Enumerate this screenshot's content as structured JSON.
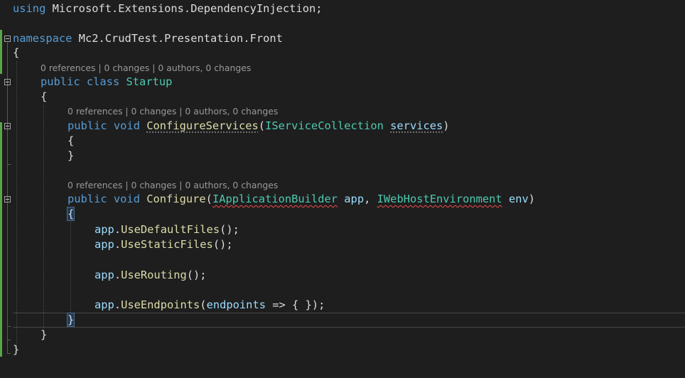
{
  "editor": {
    "code": {
      "line1": {
        "kw": "using",
        "rest": " Microsoft.Extensions.DependencyInjection;"
      },
      "line2": {
        "kw": "namespace",
        "rest": " Mc2.CrudTest.Presentation.Front"
      },
      "open_brace": "{",
      "class_decl": {
        "kw1": "public",
        "kw2": "class",
        "name": "Startup"
      },
      "configure_services": {
        "kw1": "public",
        "kw2": "void",
        "name": "ConfigureServices",
        "open": "(",
        "param_type": "IServiceCollection",
        "param_name": "services",
        "close": ")"
      },
      "configure": {
        "kw1": "public",
        "kw2": "void",
        "name": "Configure",
        "open": "(",
        "param1_type": "IApplicationBuilder",
        "param1_name": "app",
        "sep": ", ",
        "param2_type": "IWebHostEnvironment",
        "param2_name": "env",
        "close": ")"
      },
      "stmts": [
        {
          "obj": "app",
          "dot": ".",
          "method": "UseDefaultFiles",
          "tail": "();"
        },
        {
          "obj": "app",
          "dot": ".",
          "method": "UseStaticFiles",
          "tail": "();"
        },
        {
          "obj": "app",
          "dot": ".",
          "method": "UseRouting",
          "tail": "();"
        },
        {
          "obj": "app",
          "dot": ".",
          "method": "UseEndpoints",
          "open": "(",
          "arg": "endpoints",
          "tail": " => { });"
        }
      ],
      "close_brace": "}"
    },
    "codelens": "0 references | 0 changes | 0 authors, 0 changes",
    "fold_icon": "collapse-minus-icon"
  }
}
